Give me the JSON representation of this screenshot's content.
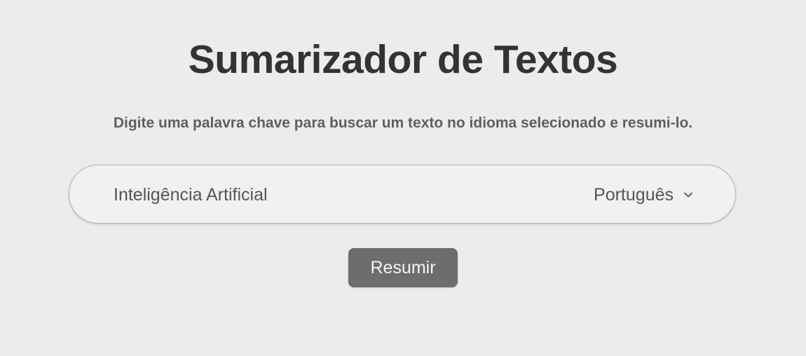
{
  "header": {
    "title": "Sumarizador de Textos",
    "subtitle": "Digite uma palavra chave para buscar um texto no idioma selecionado e resumi-lo."
  },
  "search": {
    "value": "Inteligência Artificial",
    "language": {
      "selected": "Português",
      "icon": "chevron-down-icon"
    }
  },
  "actions": {
    "submit_label": "Resumir"
  },
  "colors": {
    "background": "#ececec",
    "title": "#333333",
    "subtitle": "#5f5f5f",
    "input_background": "#f1f1f1",
    "button_background": "#6d6d6d",
    "button_text": "#f5f5f5"
  }
}
